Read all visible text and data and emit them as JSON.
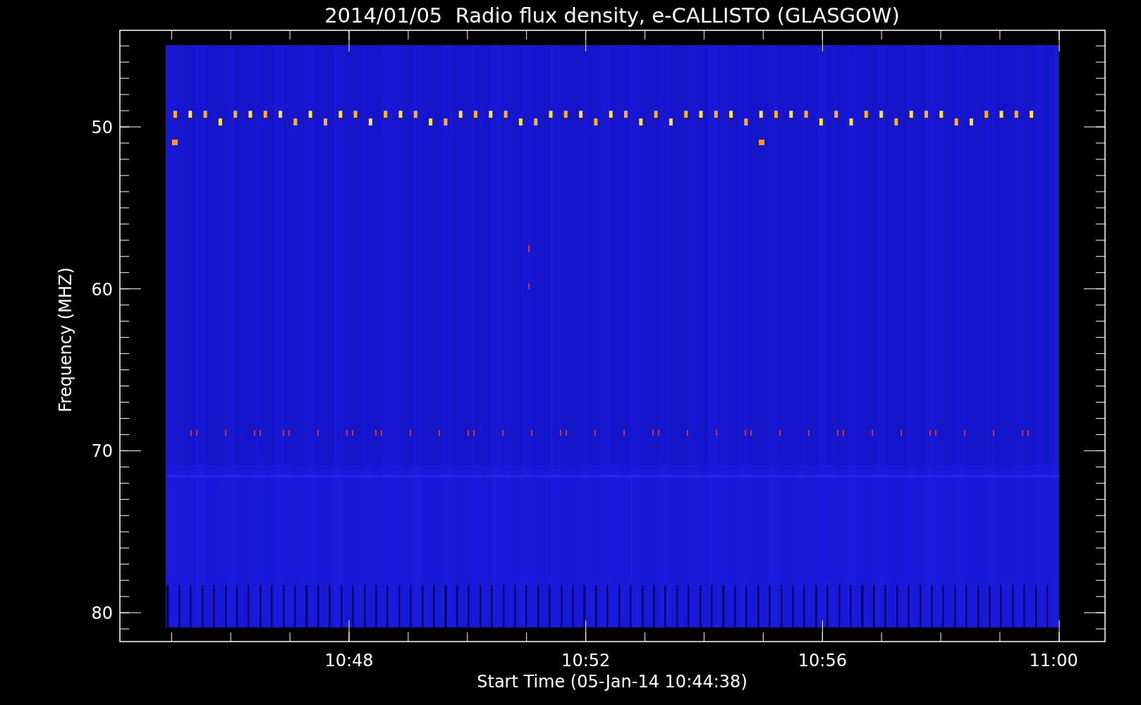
{
  "title": "2014/01/05  Radio flux density, e-CALLISTO (GLASGOW)",
  "y_axis": {
    "label": "Frequency (MHZ)",
    "ticks": [
      "50",
      "60",
      "70",
      "80"
    ]
  },
  "x_axis": {
    "label": "Start Time (05-Jan-14 10:44:38)",
    "ticks": [
      "10:48",
      "10:52",
      "10:56",
      "11:00"
    ]
  }
}
